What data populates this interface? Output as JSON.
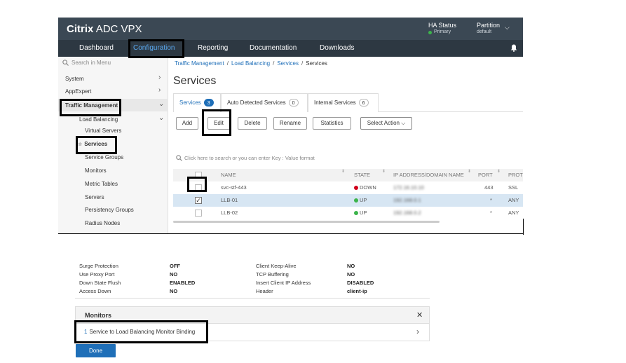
{
  "header": {
    "brand_bold": "Citrix",
    "brand_rest": "ADC VPX",
    "ha_status_label": "HA Status",
    "ha_status_value": "Primary",
    "partition_label": "Partition",
    "partition_value": "default"
  },
  "nav": {
    "items": [
      "Dashboard",
      "Configuration",
      "Reporting",
      "Documentation",
      "Downloads"
    ]
  },
  "sidebar": {
    "search_placeholder": "Search in Menu",
    "items": [
      {
        "label": "System"
      },
      {
        "label": "AppExpert"
      },
      {
        "label": "Traffic Management"
      },
      {
        "label": "Load Balancing"
      },
      {
        "label": "Virtual Servers"
      },
      {
        "label": "Services"
      },
      {
        "label": "Service Groups"
      },
      {
        "label": "Monitors"
      },
      {
        "label": "Metric Tables"
      },
      {
        "label": "Servers"
      },
      {
        "label": "Persistency Groups"
      },
      {
        "label": "Radius Nodes"
      }
    ]
  },
  "breadcrumb": {
    "items": [
      "Traffic Management",
      "Load Balancing",
      "Services",
      "Services"
    ]
  },
  "page": {
    "title": "Services"
  },
  "tabs": [
    {
      "label": "Services",
      "count": "3"
    },
    {
      "label": "Auto Detected Services",
      "count": "0"
    },
    {
      "label": "Internal Services",
      "count": "6"
    }
  ],
  "toolbar": {
    "add": "Add",
    "edit": "Edit",
    "delete": "Delete",
    "rename": "Rename",
    "statistics": "Statistics",
    "select_action": "Select Action"
  },
  "table_search": {
    "placeholder": "Click here to search or you can enter Key : Value format"
  },
  "table": {
    "columns": [
      "NAME",
      "STATE",
      "IP ADDRESS/DOMAIN NAME",
      "PORT",
      "PROTO"
    ],
    "rows": [
      {
        "name": "svc-stf-443",
        "state": "DOWN",
        "ip": "172.16.10.10",
        "port": "443",
        "proto": "SSL"
      },
      {
        "name": "LLB-01",
        "state": "UP",
        "ip": "192.168.0.1",
        "port": "*",
        "proto": "ANY"
      },
      {
        "name": "LLB-02",
        "state": "UP",
        "ip": "192.168.0.2",
        "port": "*",
        "proto": "ANY"
      }
    ]
  },
  "colors": {
    "header_bg": "#3b4854",
    "nav_bg": "#2d3842",
    "accent": "#1f6fb8",
    "state_down": "#d0021b",
    "state_up": "#3cb44b",
    "selected_row": "#d7e6f3"
  },
  "properties": {
    "left": [
      {
        "label": "Surge Protection",
        "value": "OFF"
      },
      {
        "label": "Use Proxy Port",
        "value": "NO"
      },
      {
        "label": "Down State Flush",
        "value": "ENABLED"
      },
      {
        "label": "Access Down",
        "value": "NO"
      }
    ],
    "right": [
      {
        "label": "Client Keep-Alive",
        "value": "NO"
      },
      {
        "label": "TCP Buffering",
        "value": "NO"
      },
      {
        "label": "Insert Client IP Address",
        "value": "DISABLED"
      },
      {
        "label": "Header",
        "value": "client-ip"
      }
    ]
  },
  "monitors": {
    "title": "Monitors",
    "binding_count": "1",
    "binding_label": "Service to Load Balancing Monitor Binding"
  },
  "done_button": "Done",
  "icons": {
    "search": "search-icon",
    "bell": "bell-icon",
    "chevron": "chevron-icon",
    "close": "close-icon",
    "star": "star-icon"
  }
}
